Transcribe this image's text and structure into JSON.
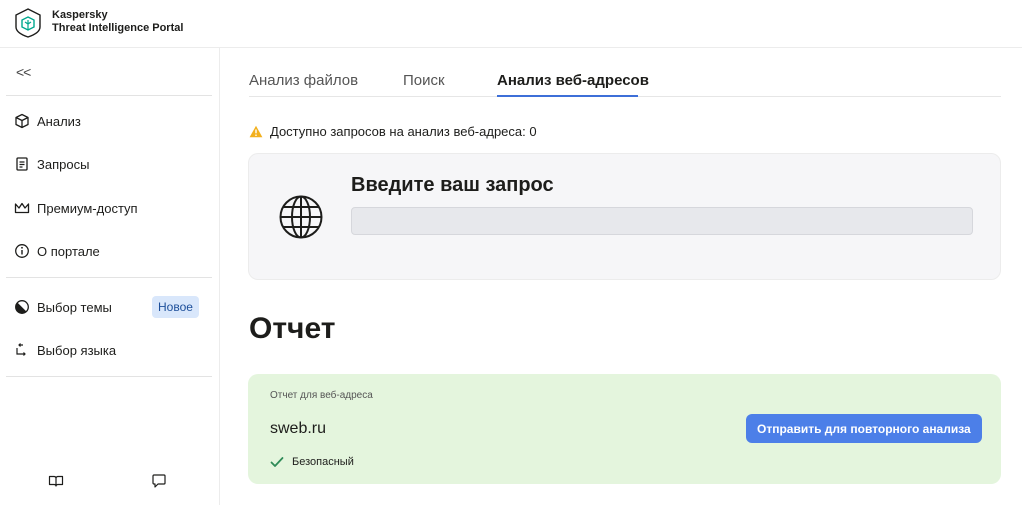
{
  "header": {
    "brand_line1": "Kaspersky",
    "brand_line2": "Threat Intelligence Portal",
    "logo_icon": "kaspersky-shield-icon"
  },
  "sidebar": {
    "collapse_label": "<<",
    "items": [
      {
        "label": "Анализ",
        "icon": "cube-icon"
      },
      {
        "label": "Запросы",
        "icon": "document-icon"
      },
      {
        "label": "Премиум-доступ",
        "icon": "crown-icon"
      },
      {
        "label": "О портале",
        "icon": "info-icon"
      },
      {
        "label": "Выбор темы",
        "icon": "theme-icon"
      },
      {
        "label": "Выбор языка",
        "icon": "language-icon"
      }
    ],
    "theme_badge": "Новое",
    "footer_icons": [
      "book-icon",
      "chat-icon"
    ]
  },
  "tabs": [
    {
      "label": "Анализ файлов",
      "active": false
    },
    {
      "label": "Поиск",
      "active": false
    },
    {
      "label": "Анализ веб-адресов",
      "active": true
    }
  ],
  "quota": {
    "text": "Доступно запросов на анализ веб-адреса: 0",
    "icon": "warning-icon"
  },
  "query": {
    "title": "Введите ваш запрос",
    "value": "",
    "placeholder": "",
    "icon": "globe-icon"
  },
  "report": {
    "title": "Отчет",
    "label": "Отчет для веб-адреса",
    "url": "sweb.ru",
    "status": "Безопасный",
    "button": "Отправить для повторного анализа"
  },
  "colors": {
    "accent": "#4c7fe8",
    "tab_underline": "#3d6fd8",
    "safe_bg": "#e4f5dd",
    "safe_check": "#2e8b57",
    "warning": "#f2b01e",
    "badge_bg": "#d9e7fb"
  }
}
